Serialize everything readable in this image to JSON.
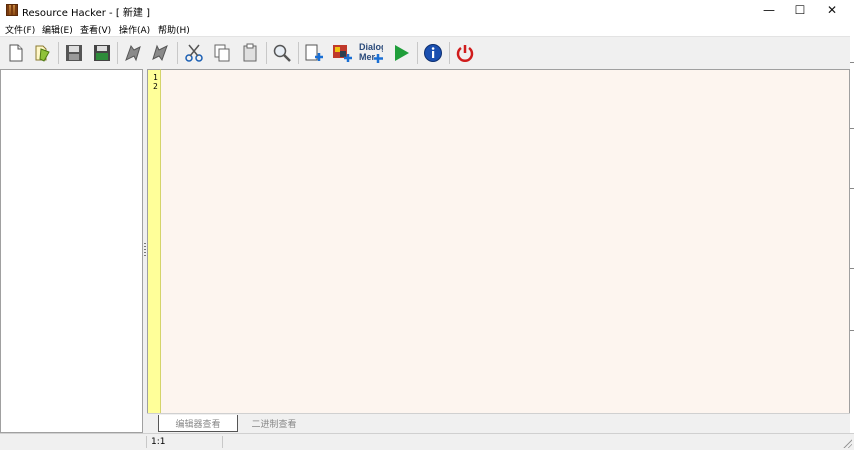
{
  "window": {
    "title": "Resource Hacker - [ 新建 ]",
    "minimize_glyph": "—",
    "maximize_glyph": "☐",
    "close_glyph": "✕"
  },
  "menu": {
    "items": [
      {
        "label": "文件(F)"
      },
      {
        "label": "编辑(E)"
      },
      {
        "label": "查看(V)"
      },
      {
        "label": "操作(A)"
      },
      {
        "label": "帮助(H)"
      }
    ]
  },
  "toolbar": {
    "icons": [
      "new-file-icon",
      "open-file-icon",
      "save-icon",
      "save-as-icon",
      "back-icon",
      "forward-icon",
      "cut-icon",
      "copy-icon",
      "paste-icon",
      "search-icon",
      "add-resource-icon",
      "add-image-icon",
      "dialog-menu-icon",
      "run-script-icon",
      "info-icon",
      "exit-icon"
    ],
    "dialog_label_line1": "Dialog",
    "dialog_label_line2": "Mer"
  },
  "editor": {
    "line_numbers": [
      "1",
      "2"
    ]
  },
  "tabs": [
    {
      "label": "编辑器查看"
    },
    {
      "label": "二进制查看"
    }
  ],
  "status": {
    "position": "1:1"
  },
  "colors": {
    "editor_background": "#fdf5ef",
    "gutter_background": "#ffff99"
  }
}
